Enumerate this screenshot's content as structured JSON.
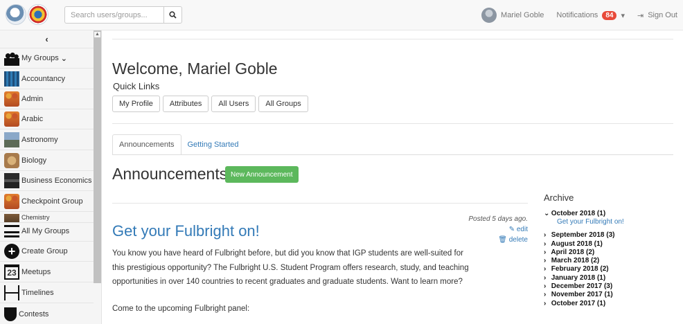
{
  "topbar": {
    "search_placeholder": "Search users/groups...",
    "search_icon": "search-icon",
    "user_name": "Mariel Goble",
    "notifications_label": "Notifications",
    "notifications_count": "84",
    "caret": "▾",
    "signout_label": "Sign Out",
    "signout_icon": "⇥"
  },
  "sidebar": {
    "collapse_icon": "‹",
    "my_groups_label": "My Groups",
    "my_groups_caret": "⌄",
    "groups": [
      {
        "label": "Accountancy"
      },
      {
        "label": "Admin"
      },
      {
        "label": "Arabic"
      },
      {
        "label": "Astronomy"
      },
      {
        "label": "Biology"
      },
      {
        "label": "Business Economics"
      },
      {
        "label": "Checkpoint Group"
      },
      {
        "label": "Chemistry"
      }
    ],
    "bottom": [
      {
        "label": "All My Groups",
        "icon": "list-icon"
      },
      {
        "label": "Create Group",
        "icon": "plus-circle-icon"
      },
      {
        "label": "Meetups",
        "icon": "calendar-icon",
        "glyph": "23"
      },
      {
        "label": "Timelines",
        "icon": "timeline-icon"
      },
      {
        "label": "Contests",
        "icon": "trophy-icon"
      }
    ]
  },
  "main": {
    "welcome": "Welcome, Mariel Goble",
    "quick_links_label": "Quick Links",
    "quick_links": [
      "My Profile",
      "Attributes",
      "All Users",
      "All Groups"
    ],
    "tabs": [
      "Announcements",
      "Getting Started"
    ],
    "announcements_title": "Announcements",
    "new_announcement": "New Announcement",
    "post": {
      "title": "Get your Fulbright on!",
      "posted": "Posted 5 days ago.",
      "edit": "edit",
      "delete": "delete",
      "body": "You know you have heard of Fulbright before, but did you know that IGP students are well-suited for this prestigious opportunity?  The Fulbright U.S. Student Program offers research, study, and teaching opportunities in over 140 countries to recent graduates and graduate students.  Want to learn more?",
      "body2": "Come to the upcoming Fulbright panel:"
    }
  },
  "archive": {
    "title": "Archive",
    "open": {
      "label": "October 2018 (1)",
      "posts": [
        "Get your Fulbright on!"
      ]
    },
    "months": [
      "September 2018 (3)",
      "August 2018 (1)",
      "April 2018 (2)",
      "March 2018 (2)",
      "February 2018 (2)",
      "January 2018 (1)",
      "December 2017 (3)",
      "November 2017 (1)",
      "October 2017 (1)"
    ]
  }
}
